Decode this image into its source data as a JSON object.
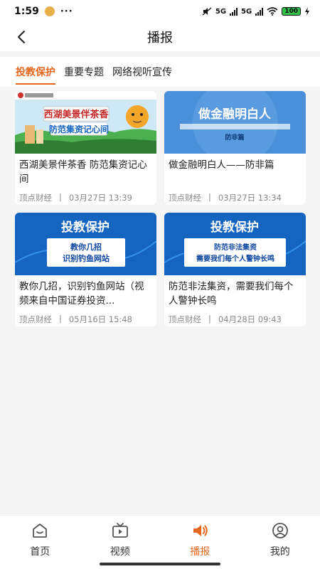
{
  "status_bar": {
    "time": "1:59",
    "dots": "···",
    "network1": "5G",
    "network2": "5G",
    "battery": "100"
  },
  "header": {
    "title": "播报",
    "back_icon": "chevron-left-icon"
  },
  "tabs": [
    {
      "label": "投教保护",
      "active": true
    },
    {
      "label": "重要专题",
      "active": false
    },
    {
      "label": "网络视听宣传",
      "active": false
    }
  ],
  "cards": [
    {
      "thumb_text": [
        "西湖美景伴茶香",
        "防范集资记心间"
      ],
      "title": "西湖美景伴茶香 防范集资记心间",
      "source": "顶点财经",
      "separator": "|",
      "date": "03月27日 13:39"
    },
    {
      "thumb_text": [
        "做金融明白人",
        "防非篇"
      ],
      "title": "做金融明白人——防非篇",
      "source": "顶点财经",
      "separator": "|",
      "date": "03月27日 13:34"
    },
    {
      "thumb_text": [
        "投教保护",
        "教你几招",
        "识别钓鱼网站"
      ],
      "title": "教你几招，识别钓鱼网站（视频来自中国证券投资...",
      "source": "顶点财经",
      "separator": "|",
      "date": "05月16日 15:48"
    },
    {
      "thumb_text": [
        "投教保护",
        "防范非法集资",
        "需要我们每个人警钟长鸣"
      ],
      "title": "防范非法集资，需要我们每个人警钟长鸣",
      "source": "顶点财经",
      "separator": "|",
      "date": "04月28日 09:43"
    }
  ],
  "bottom_nav": [
    {
      "label": "首页",
      "icon": "home-icon",
      "active": false
    },
    {
      "label": "视频",
      "icon": "tv-icon",
      "active": false
    },
    {
      "label": "播报",
      "icon": "speaker-icon",
      "active": true
    },
    {
      "label": "我的",
      "icon": "user-icon",
      "active": false
    }
  ],
  "colors": {
    "accent": "#e8671e",
    "thumb_blue": "#1565c0",
    "background": "#f5f5f5"
  }
}
